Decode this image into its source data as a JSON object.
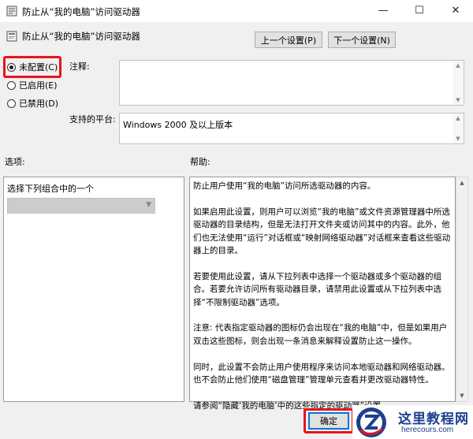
{
  "window": {
    "title": "防止从“我的电脑”访问驱动器",
    "minimize_glyph": "—",
    "maximize_glyph": "☐",
    "close_glyph": "✕"
  },
  "header": {
    "title": "防止从“我的电脑”访问驱动器",
    "icon": "policy-setting-icon"
  },
  "nav": {
    "prev_label": "上一个设置(P)",
    "next_label": "下一个设置(N)"
  },
  "state_options": [
    {
      "label": "未配置(C)",
      "selected": true
    },
    {
      "label": "已启用(E)",
      "selected": false
    },
    {
      "label": "已禁用(D)",
      "selected": false
    }
  ],
  "comment": {
    "label": "注释:",
    "value": ""
  },
  "platform": {
    "label": "支持的平台:",
    "value": "Windows 2000 及以上版本"
  },
  "options": {
    "label": "选项:",
    "caption": "选择下列组合中的一个",
    "selected": ""
  },
  "help": {
    "label": "帮助:",
    "paragraphs": [
      "防止用户使用“我的电脑”访问所选驱动器的内容。",
      "如果启用此设置，则用户可以浏览“我的电脑”或文件资源管理器中所选驱动器的目录结构，但是无法打开文件夹或访问其中的内容。此外，他们也无法使用“运行”对话框或“映射网络驱动器”对话框来查看这些驱动器上的目录。",
      "若要使用此设置，请从下拉列表中选择一个驱动器或多个驱动器的组合。若要允许访问所有驱动器目录，请禁用此设置或从下拉列表中选择“不限制驱动器”选项。",
      "注意: 代表指定驱动器的图标仍会出现在“我的电脑”中，但是如果用户双击这些图标，则会出现一条消息来解释设置防止这一操作。",
      " 同时，此设置不会防止用户使用程序来访问本地驱动器和网络驱动器。也不会防止他们使用“磁盘管理”管理单元查看并更改驱动器特性。",
      "请参阅“隐藏‘我的电脑’中的这些指定的驱动器”设置。"
    ]
  },
  "footer": {
    "ok_label": "确定"
  },
  "watermark": {
    "title": "这里教程网",
    "url": "herecours.com"
  },
  "colors": {
    "highlight_red": "#e8141e",
    "watermark_blue": "#1d3f8f",
    "focus_blue": "#0078d7"
  }
}
